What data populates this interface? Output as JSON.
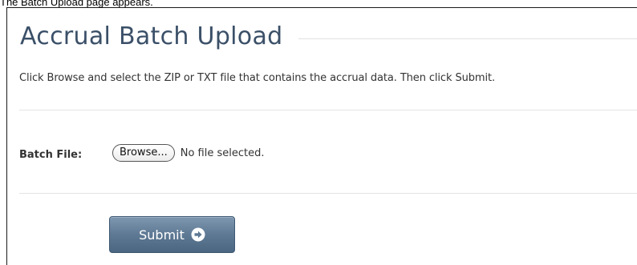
{
  "caption": "The Batch Upload page appears.",
  "page": {
    "title": "Accrual Batch Upload",
    "instructions": "Click Browse and select the ZIP or TXT file that contains the accrual data. Then click Submit."
  },
  "form": {
    "batch_file_label": "Batch File:",
    "browse_label": "Browse...",
    "file_status": "No file selected.",
    "submit_label": "Submit",
    "submit_icon": "arrow-right-circle-icon"
  },
  "colors": {
    "title": "#3b5068",
    "submit_bg": "#5e7994",
    "submit_text": "#ffffff"
  }
}
